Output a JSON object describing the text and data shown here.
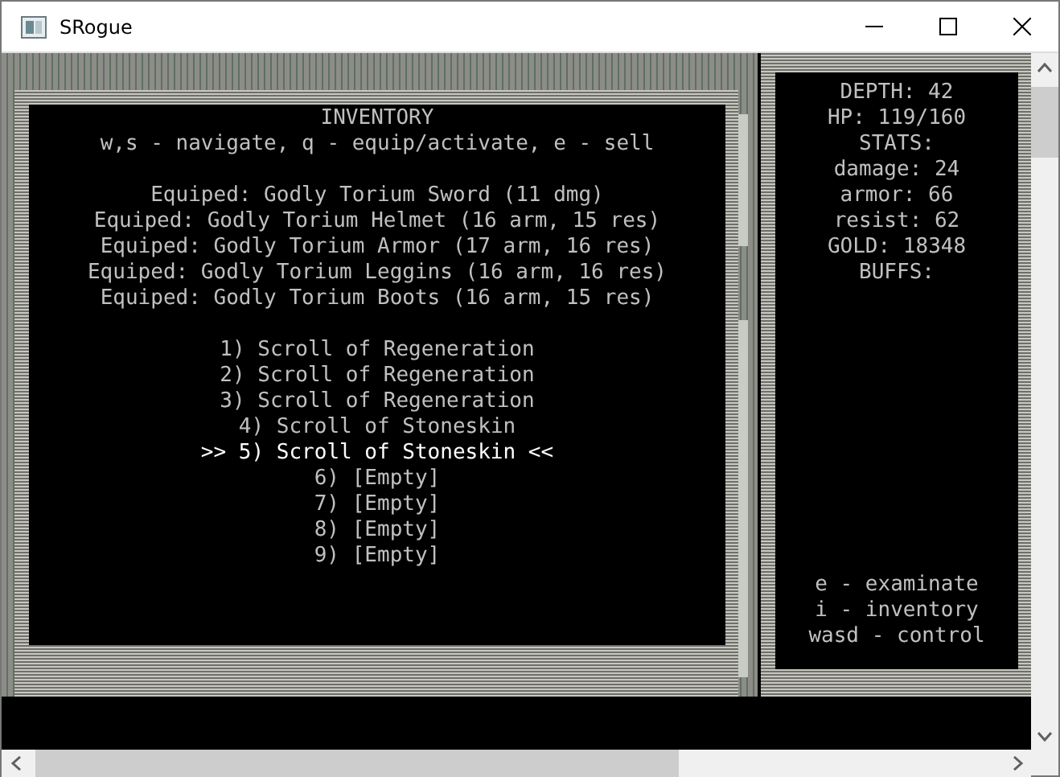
{
  "window": {
    "title": "SRogue"
  },
  "inventory": {
    "title": "INVENTORY",
    "help": "w,s - navigate, q - equip/activate, e - sell",
    "equipped": [
      "Equiped: Godly Torium Sword (11 dmg)",
      "Equiped: Godly Torium Helmet (16 arm, 15 res)",
      "Equiped: Godly Torium Armor (17 arm, 16 res)",
      "Equiped: Godly Torium Leggins (16 arm, 16 res)",
      "Equiped: Godly Torium Boots (16 arm, 15 res)"
    ],
    "slots": [
      {
        "label": "1) Scroll of Regeneration",
        "selected": false
      },
      {
        "label": "2) Scroll of Regeneration",
        "selected": false
      },
      {
        "label": "3) Scroll of Regeneration",
        "selected": false
      },
      {
        "label": "4) Scroll of Stoneskin",
        "selected": false
      },
      {
        "label": ">> 5) Scroll of Stoneskin <<",
        "selected": true
      },
      {
        "label": "6) [Empty]",
        "selected": false
      },
      {
        "label": "7) [Empty]",
        "selected": false
      },
      {
        "label": "8) [Empty]",
        "selected": false
      },
      {
        "label": "9) [Empty]",
        "selected": false
      }
    ]
  },
  "stats": [
    "DEPTH: 42",
    "HP: 119/160",
    "STATS:",
    "damage: 24",
    "armor: 66",
    "resist: 62",
    "GOLD: 18348",
    "BUFFS:"
  ],
  "controls": [
    "e - examinate",
    "i - inventory",
    "wasd - control"
  ]
}
